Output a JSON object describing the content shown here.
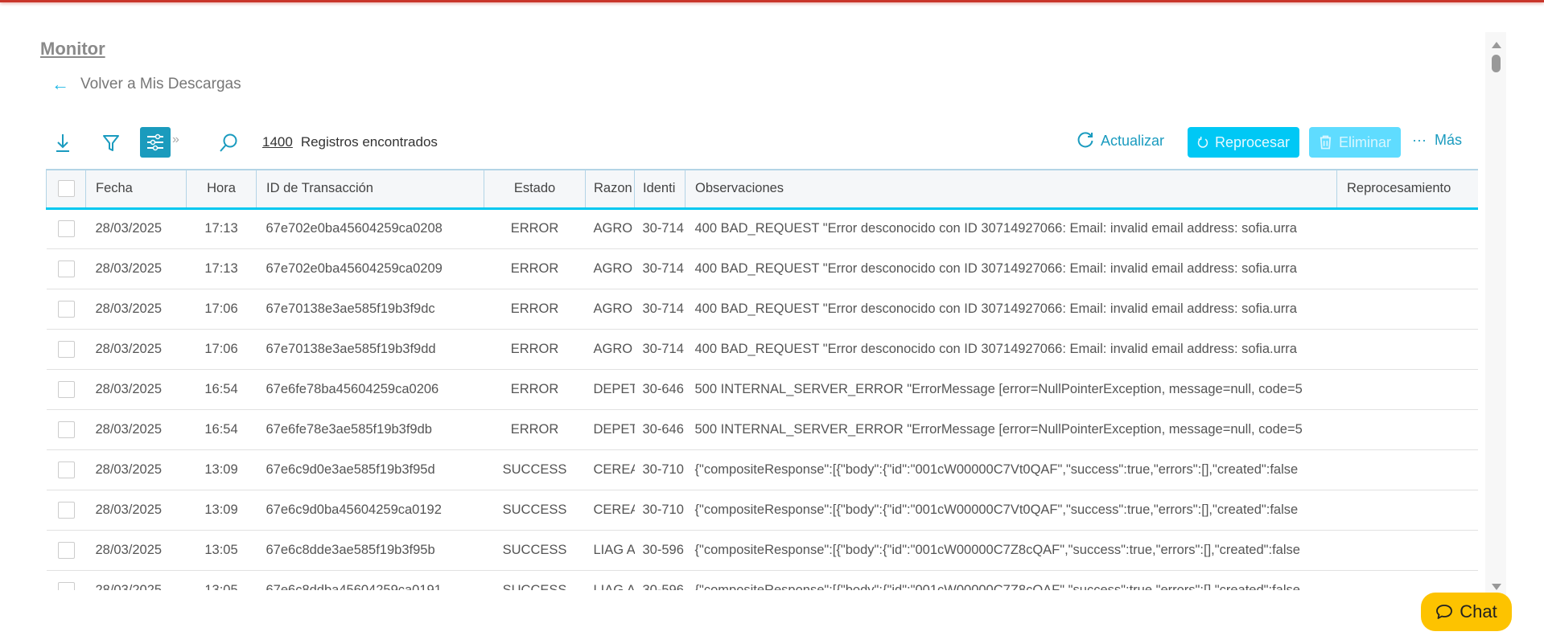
{
  "header": {
    "title": "Monitor",
    "back_label": "Volver a Mis Descargas"
  },
  "toolbar": {
    "count": "1400",
    "count_label": "Registros encontrados",
    "refresh": "Actualizar",
    "reprocess": "Reprocesar",
    "delete": "Eliminar",
    "more": "Más",
    "icons": [
      "download-icon",
      "filter-icon",
      "sliders-icon",
      "search-icon"
    ]
  },
  "colors": {
    "accent": "#1a9bbf",
    "primary_button": "#00c8f5",
    "disabled_button": "#5fdcff",
    "chat": "#fdc300",
    "top_bar": "#c9362b"
  },
  "table": {
    "columns": [
      "Fecha",
      "Hora",
      "ID de Transacción",
      "Estado",
      "Razon",
      "Identi",
      "Observaciones",
      "Reprocesamiento"
    ],
    "rows": [
      {
        "fecha": "28/03/2025",
        "hora": "17:13",
        "id": "67e702e0ba45604259ca0208",
        "estado": "ERROR",
        "razon": "AGRO",
        "ident": "30-714",
        "obs": "400 BAD_REQUEST \"Error desconocido con ID 30714927066: Email: invalid email address: sofia.urra",
        "repro": ""
      },
      {
        "fecha": "28/03/2025",
        "hora": "17:13",
        "id": "67e702e0ba45604259ca0209",
        "estado": "ERROR",
        "razon": "AGRO",
        "ident": "30-714",
        "obs": "400 BAD_REQUEST \"Error desconocido con ID 30714927066: Email: invalid email address: sofia.urra",
        "repro": ""
      },
      {
        "fecha": "28/03/2025",
        "hora": "17:06",
        "id": "67e70138e3ae585f19b3f9dc",
        "estado": "ERROR",
        "razon": "AGRO",
        "ident": "30-714",
        "obs": "400 BAD_REQUEST \"Error desconocido con ID 30714927066: Email: invalid email address: sofia.urra",
        "repro": ""
      },
      {
        "fecha": "28/03/2025",
        "hora": "17:06",
        "id": "67e70138e3ae585f19b3f9dd",
        "estado": "ERROR",
        "razon": "AGRO",
        "ident": "30-714",
        "obs": "400 BAD_REQUEST \"Error desconocido con ID 30714927066: Email: invalid email address: sofia.urra",
        "repro": ""
      },
      {
        "fecha": "28/03/2025",
        "hora": "16:54",
        "id": "67e6fe78ba45604259ca0206",
        "estado": "ERROR",
        "razon": "DEPET",
        "ident": "30-646",
        "obs": "500 INTERNAL_SERVER_ERROR \"ErrorMessage [error=NullPointerException, message=null, code=5",
        "repro": ""
      },
      {
        "fecha": "28/03/2025",
        "hora": "16:54",
        "id": "67e6fe78e3ae585f19b3f9db",
        "estado": "ERROR",
        "razon": "DEPET",
        "ident": "30-646",
        "obs": "500 INTERNAL_SERVER_ERROR \"ErrorMessage [error=NullPointerException, message=null, code=5",
        "repro": ""
      },
      {
        "fecha": "28/03/2025",
        "hora": "13:09",
        "id": "67e6c9d0e3ae585f19b3f95d",
        "estado": "SUCCESS",
        "razon": "CEREA",
        "ident": "30-710",
        "obs": "{\"compositeResponse\":[{\"body\":{\"id\":\"001cW00000C7Vt0QAF\",\"success\":true,\"errors\":[],\"created\":false",
        "repro": ""
      },
      {
        "fecha": "28/03/2025",
        "hora": "13:09",
        "id": "67e6c9d0ba45604259ca0192",
        "estado": "SUCCESS",
        "razon": "CEREA",
        "ident": "30-710",
        "obs": "{\"compositeResponse\":[{\"body\":{\"id\":\"001cW00000C7Vt0QAF\",\"success\":true,\"errors\":[],\"created\":false",
        "repro": ""
      },
      {
        "fecha": "28/03/2025",
        "hora": "13:05",
        "id": "67e6c8dde3ae585f19b3f95b",
        "estado": "SUCCESS",
        "razon": "LIAG A",
        "ident": "30-596",
        "obs": "{\"compositeResponse\":[{\"body\":{\"id\":\"001cW00000C7Z8cQAF\",\"success\":true,\"errors\":[],\"created\":false",
        "repro": ""
      },
      {
        "fecha": "28/03/2025",
        "hora": "13:05",
        "id": "67e6c8ddba45604259ca0191",
        "estado": "SUCCESS",
        "razon": "LIAG A",
        "ident": "30-596",
        "obs": "{\"compositeResponse\":[{\"body\":{\"id\":\"001cW00000C7Z8cQAF\",\"success\":true,\"errors\":[],\"created\":false",
        "repro": ""
      }
    ]
  },
  "chat": {
    "label": "Chat"
  }
}
